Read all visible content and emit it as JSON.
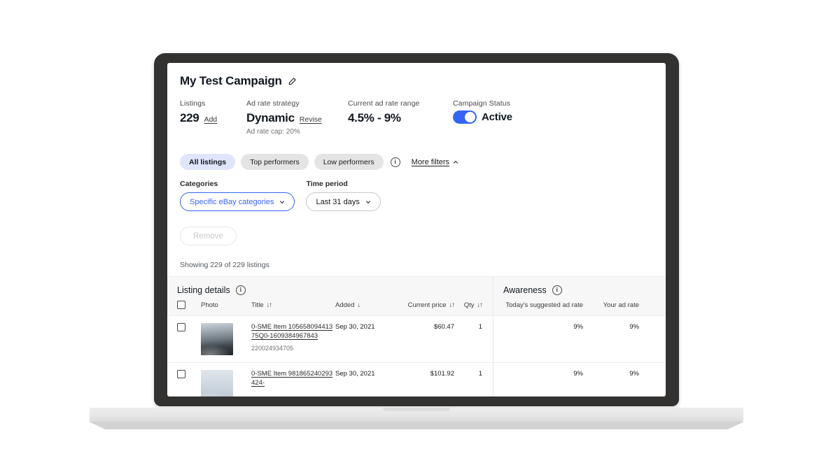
{
  "header": {
    "campaign_title": "My Test Campaign",
    "edit_icon": "pencil-icon"
  },
  "summary": {
    "listings": {
      "label": "Listings",
      "value": "229",
      "action": "Add"
    },
    "ad_rate_strategy": {
      "label": "Ad rate strategy",
      "value": "Dynamic",
      "action": "Revise",
      "sub": "Ad rate cap: 20%"
    },
    "current_ad_rate_range": {
      "label": "Current ad rate range",
      "value": "4.5% - 9%"
    },
    "campaign_status": {
      "label": "Campaign Status",
      "state": "Active",
      "toggle_on": true
    }
  },
  "filters": {
    "chips": [
      {
        "label": "All listings",
        "active": true
      },
      {
        "label": "Top performers",
        "active": false
      },
      {
        "label": "Low performers",
        "active": false
      }
    ],
    "info_icon": "info-icon",
    "more_filters": {
      "label": "More filters",
      "icon": "chevron-up-icon"
    },
    "categories": {
      "label": "Categories",
      "value": "Specific eBay categories"
    },
    "time_period": {
      "label": "Time period",
      "value": "Last 31 days"
    },
    "remove_button": "Remove"
  },
  "results": {
    "showing": "Showing 229 of 229 listings"
  },
  "table": {
    "groups": {
      "listing_details": "Listing details",
      "awareness": "Awareness"
    },
    "columns": {
      "photo": "Photo",
      "title": "Title",
      "added": "Added",
      "current_price": "Current price",
      "qty": "Qty",
      "suggested_ad_rate": "Today's suggested ad rate",
      "your_ad_rate": "Your ad rate"
    },
    "sort_glyphs": {
      "both": "↓↑",
      "down": "↓"
    },
    "rows": [
      {
        "title": "0-SME Item 10565809441375Q0-1609384967843",
        "item_id": "220024934705",
        "added": "Sep 30, 2021",
        "current_price": "$60.47",
        "qty": "1",
        "suggested_ad_rate": "9%",
        "your_ad_rate": "9%"
      },
      {
        "title": "0-SME Item 981865240293424-",
        "item_id": "",
        "added": "Sep 30, 2021",
        "current_price": "$101.92",
        "qty": "1",
        "suggested_ad_rate": "9%",
        "your_ad_rate": "9%"
      }
    ]
  },
  "colors": {
    "accent_blue": "#3665F3",
    "chip_active_bg": "#DFE5FA",
    "chip_bg": "#E4E4E4",
    "bezel": "#343231"
  }
}
